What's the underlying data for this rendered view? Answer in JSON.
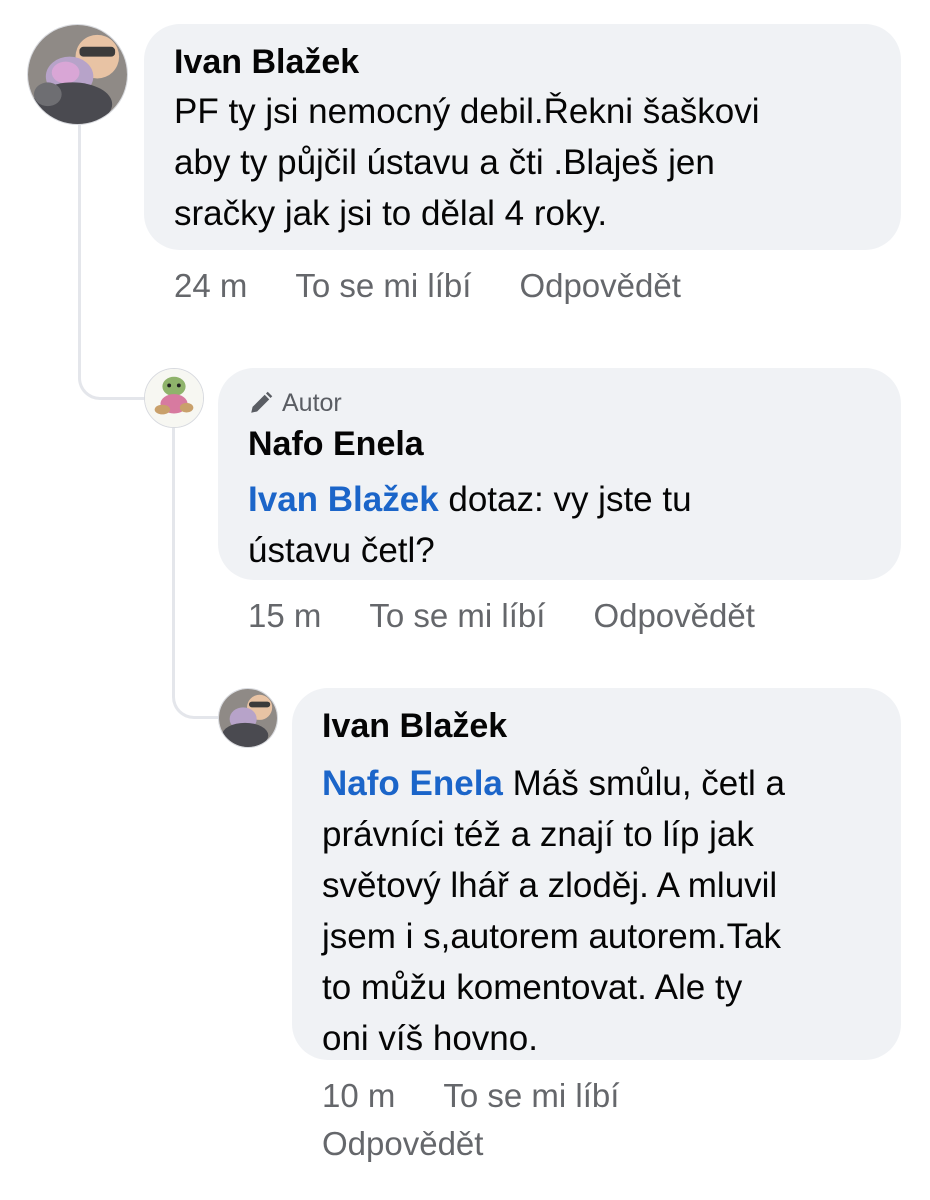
{
  "comments": [
    {
      "author": "Ivan Blažek",
      "text": "PF ty jsi nemocný debil.Řekni šaškovi aby ty půjčil ústavu a čti  .Blaješ jen sračky jak jsi to dělal 4 roky.",
      "lines": [
        "PF ty jsi nemocný debil.Řekni šaškovi",
        "aby ty půjčil ústavu a čti  .Blaješ jen",
        "sračky jak jsi to dělal 4 roky."
      ],
      "time": "24 m",
      "like_label": "To se mi líbí",
      "reply_label": "Odpovědět"
    },
    {
      "badge": "Autor",
      "author": "Nafo Enela",
      "mention": "Ivan Blažek",
      "line1_rest": " dotaz: vy jste tu",
      "line2": "ústavu četl?",
      "time": "15 m",
      "like_label": "To se mi líbí",
      "reply_label": "Odpovědět"
    },
    {
      "author": "Ivan Blažek",
      "mention": "Nafo Enela",
      "line1_rest": " Máš smůlu, četl a",
      "lines": [
        "právníci též a znají to líp jak",
        "světový lhář a zloděj. A mluvil",
        "jsem i s,autorem autorem.Tak",
        "to můžu komentovat. Ale ty",
        "oni víš hovno."
      ],
      "time": "10 m",
      "like_label": "To se mi líbí",
      "reply_label": "Odpovědět"
    }
  ],
  "icons": {
    "badge_icon": "pencil-icon"
  },
  "colors": {
    "bubble": "#f0f2f5",
    "mention": "#1b65c9",
    "meta": "#65676b",
    "thread_line": "#e4e6eb"
  }
}
